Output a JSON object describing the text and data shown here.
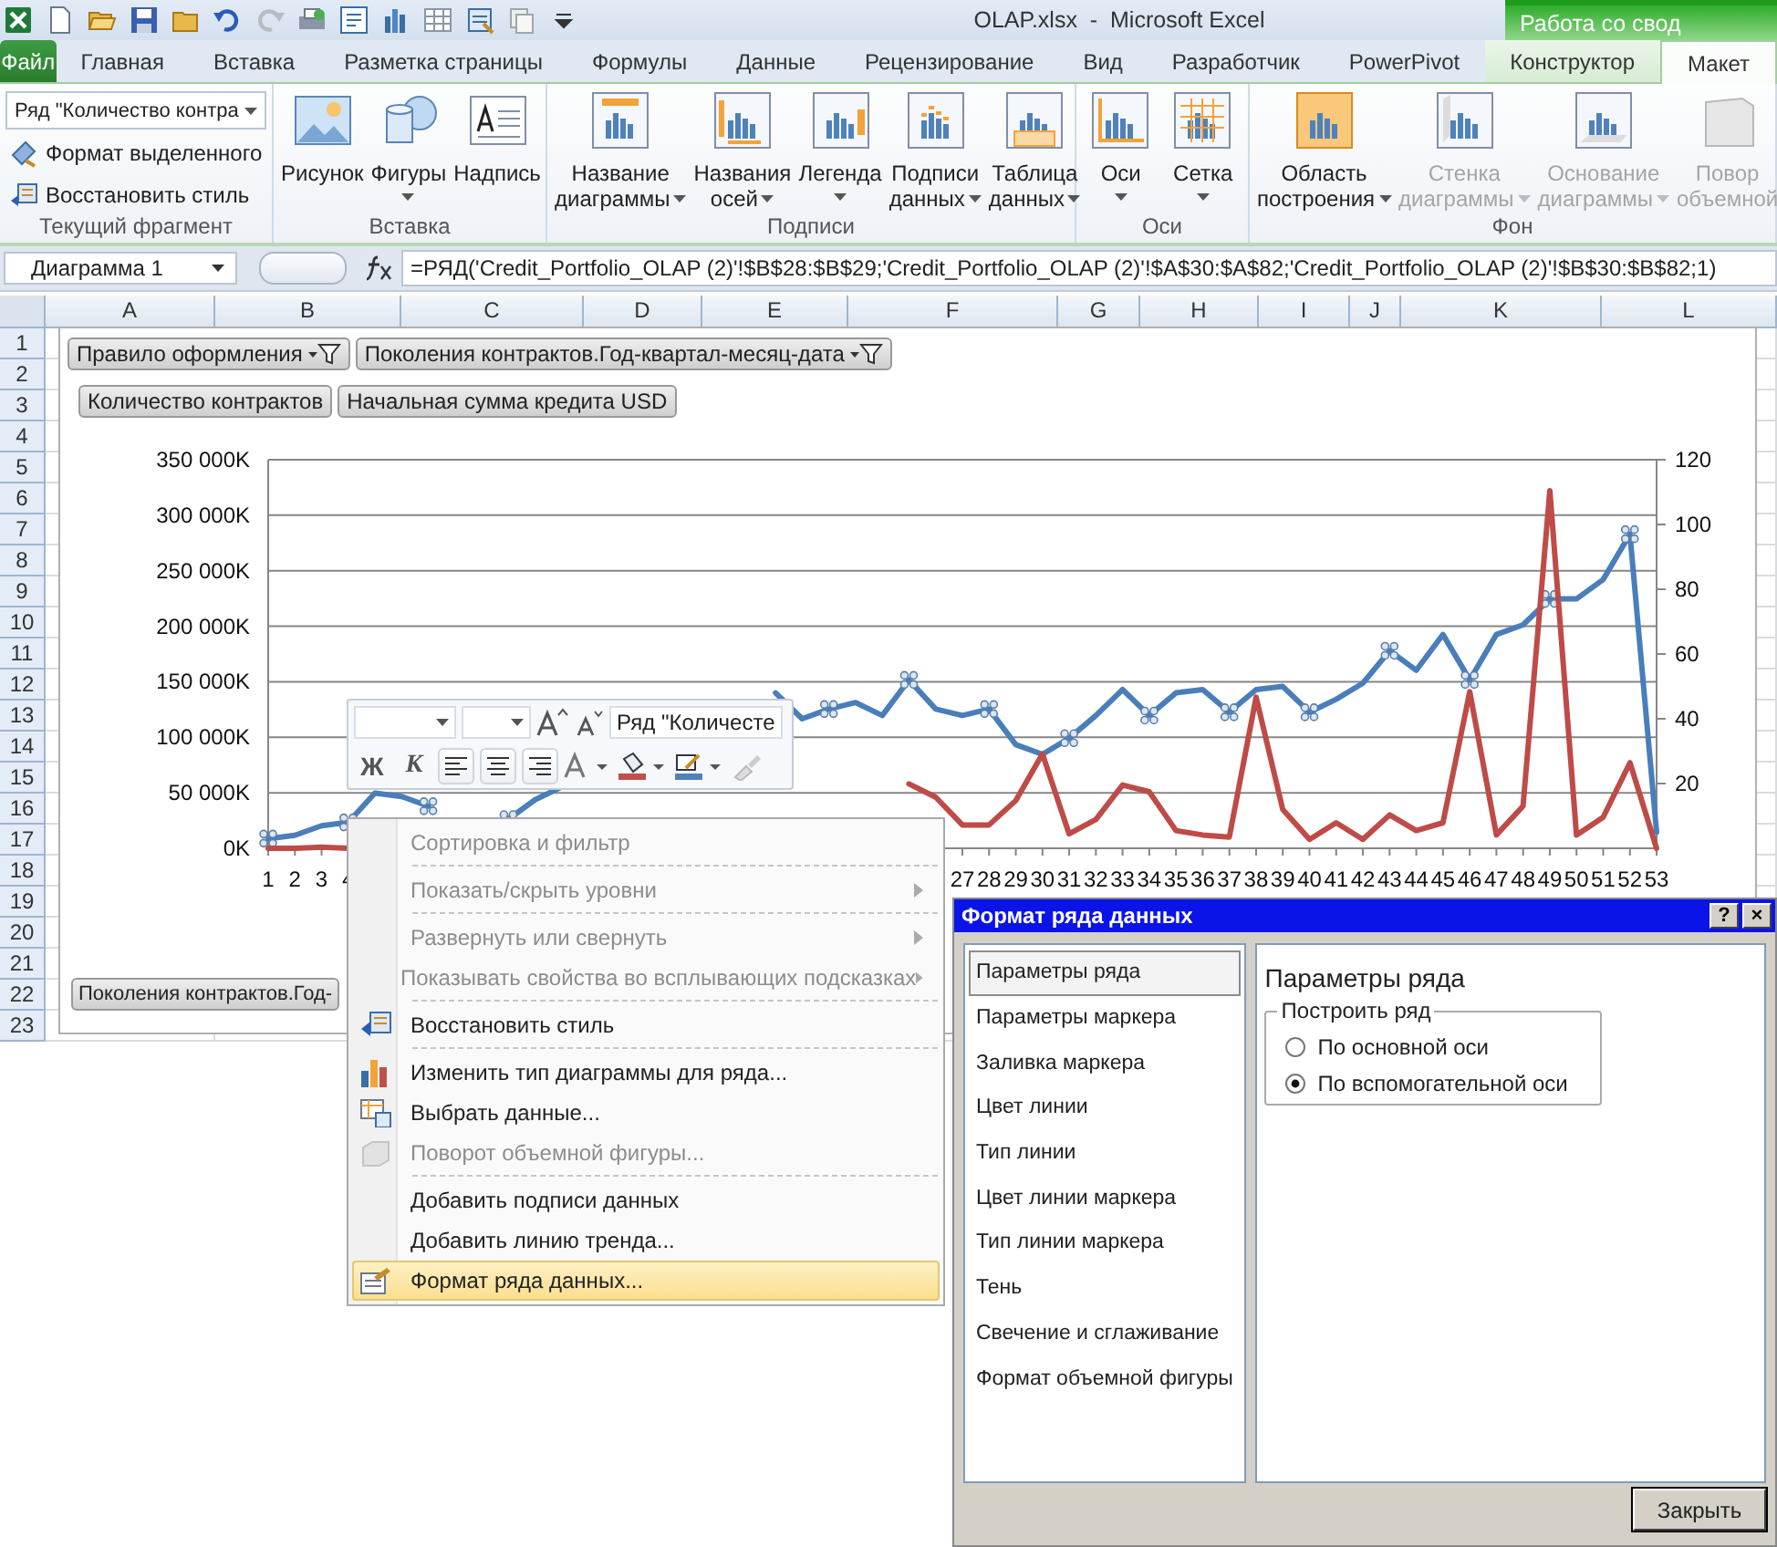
{
  "window": {
    "title": "OLAP.xlsx  -  Microsoft Excel",
    "contextual_header": "Работа со свод"
  },
  "tabs": [
    {
      "label": "Файл",
      "kind": "file",
      "selected": false
    },
    {
      "label": "Главная",
      "kind": "normal",
      "selected": false
    },
    {
      "label": "Вставка",
      "kind": "normal",
      "selected": false
    },
    {
      "label": "Разметка страницы",
      "kind": "normal",
      "selected": false
    },
    {
      "label": "Формулы",
      "kind": "normal",
      "selected": false
    },
    {
      "label": "Данные",
      "kind": "normal",
      "selected": false
    },
    {
      "label": "Рецензирование",
      "kind": "normal",
      "selected": false
    },
    {
      "label": "Вид",
      "kind": "normal",
      "selected": false
    },
    {
      "label": "Разработчик",
      "kind": "normal",
      "selected": false
    },
    {
      "label": "PowerPivot",
      "kind": "normal",
      "selected": false
    },
    {
      "label": "Конструктор",
      "kind": "contextual",
      "selected": false
    },
    {
      "label": "Макет",
      "kind": "contextual",
      "selected": true
    }
  ],
  "ribbon": {
    "groups": [
      {
        "label": "Текущий фрагмент",
        "kind": "selection",
        "selector": "Ряд \"Количество контра",
        "buttons": [
          {
            "label": "Формат выделенного"
          },
          {
            "label": "Восстановить стиль"
          }
        ]
      },
      {
        "label": "Вставка",
        "kind": "large",
        "buttons": [
          {
            "lines": [
              "Рисунок"
            ],
            "dropdown": false,
            "disabled": false
          },
          {
            "lines": [
              "Фигуры"
            ],
            "dropdown": true,
            "disabled": false
          },
          {
            "lines": [
              "Надпись"
            ],
            "dropdown": false,
            "disabled": false
          }
        ]
      },
      {
        "label": "Подписи",
        "kind": "large",
        "buttons": [
          {
            "lines": [
              "Название",
              "диаграммы"
            ],
            "dropdown": true,
            "disabled": false
          },
          {
            "lines": [
              "Названия",
              "осей"
            ],
            "dropdown": true,
            "disabled": false
          },
          {
            "lines": [
              "Легенда"
            ],
            "dropdown": true,
            "disabled": false
          },
          {
            "lines": [
              "Подписи",
              "данных"
            ],
            "dropdown": true,
            "disabled": false
          },
          {
            "lines": [
              "Таблица",
              "данных"
            ],
            "dropdown": true,
            "disabled": false
          }
        ]
      },
      {
        "label": "Оси",
        "kind": "large",
        "buttons": [
          {
            "lines": [
              "Оси"
            ],
            "dropdown": true,
            "disabled": false
          },
          {
            "lines": [
              "Сетка"
            ],
            "dropdown": true,
            "disabled": false
          }
        ]
      },
      {
        "label": "Фон",
        "kind": "large",
        "buttons": [
          {
            "lines": [
              "Область",
              "построения"
            ],
            "dropdown": true,
            "disabled": false
          },
          {
            "lines": [
              "Стенка",
              "диаграммы"
            ],
            "dropdown": true,
            "disabled": true
          },
          {
            "lines": [
              "Основание",
              "диаграммы"
            ],
            "dropdown": true,
            "disabled": true
          },
          {
            "lines": [
              "Повор",
              "объемной"
            ],
            "dropdown": false,
            "disabled": true
          }
        ]
      }
    ]
  },
  "formula_bar": {
    "name_box": "Диаграмма 1",
    "formula": "=РЯД('Credit_Portfolio_OLAP (2)'!$B$28:$B$29;'Credit_Portfolio_OLAP (2)'!$A$30:$A$82;'Credit_Portfolio_OLAP (2)'!$B$30:$B$82;1)"
  },
  "sheet": {
    "columns": [
      "A",
      "B",
      "C",
      "D",
      "E",
      "F",
      "G",
      "H",
      "I",
      "J",
      "K",
      "L"
    ],
    "rows": [
      "1",
      "2",
      "3",
      "4",
      "5",
      "6",
      "7",
      "8",
      "9",
      "10",
      "11",
      "12",
      "13",
      "14",
      "15",
      "16",
      "17",
      "18",
      "19",
      "20",
      "21",
      "22",
      "23"
    ]
  },
  "chart": {
    "filter_buttons": [
      {
        "label": "Правило оформления",
        "filter": true
      },
      {
        "label": "Поколения контрактов.Год-квартал-месяц-дата",
        "filter": true
      }
    ],
    "axis_button": "Поколения контрактов.Год-",
    "chart_data": {
      "type": "line",
      "x": [
        1,
        2,
        3,
        4,
        5,
        6,
        7,
        8,
        9,
        10,
        11,
        12,
        13,
        14,
        15,
        16,
        17,
        18,
        19,
        20,
        21,
        22,
        23,
        24,
        25,
        26,
        27,
        28,
        29,
        30,
        31,
        32,
        33,
        34,
        35,
        36,
        37,
        38,
        39,
        40,
        41,
        42,
        43,
        44,
        45,
        46,
        47,
        48,
        49,
        50,
        51,
        52,
        53
      ],
      "xlim": [
        1,
        53
      ],
      "xticks": [
        1,
        2,
        3,
        4,
        27,
        28,
        29,
        30,
        31,
        32,
        33,
        34,
        35,
        36,
        37,
        38,
        39,
        40,
        41,
        42,
        43,
        44,
        45,
        46,
        47,
        48,
        49,
        50,
        51,
        52,
        53
      ],
      "grid": true,
      "ylim": [
        0,
        350000
      ],
      "yticks": [
        {
          "value": 0,
          "label": "0K"
        },
        {
          "value": 50000,
          "label": "50 000K"
        },
        {
          "value": 100000,
          "label": "100 000K"
        },
        {
          "value": 150000,
          "label": "150 000K"
        },
        {
          "value": 200000,
          "label": "200 000K"
        },
        {
          "value": 250000,
          "label": "250 000K"
        },
        {
          "value": 300000,
          "label": "300 000K"
        },
        {
          "value": 350000,
          "label": "350 000K"
        }
      ],
      "y2lim": [
        0,
        120
      ],
      "y2ticks": [
        20,
        40,
        60,
        80,
        100,
        120
      ],
      "series": [
        {
          "name": "Количество контрактов",
          "color": "#4a7ebb",
          "axis": "y2",
          "values": [
            3,
            4,
            7,
            8,
            17,
            16,
            13,
            null,
            null,
            9,
            15,
            19,
            null,
            null,
            null,
            null,
            null,
            null,
            null,
            48,
            40,
            43,
            45,
            41,
            52,
            43,
            41,
            43,
            32,
            29,
            34,
            41,
            49,
            41,
            48,
            49,
            42,
            49,
            50,
            42,
            46,
            51,
            61,
            55,
            66,
            52,
            66,
            69,
            77,
            77,
            83,
            97,
            5
          ]
        },
        {
          "name": "Начальная сумма кредита USD",
          "color": "#be4b48",
          "values": [
            0,
            0,
            1000,
            0,
            null,
            null,
            null,
            null,
            null,
            null,
            null,
            null,
            null,
            null,
            null,
            null,
            null,
            null,
            null,
            null,
            null,
            null,
            null,
            null,
            58000,
            46000,
            21000,
            21000,
            43000,
            85000,
            13000,
            26000,
            57000,
            51000,
            16000,
            12000,
            10000,
            136000,
            35000,
            8000,
            23000,
            8000,
            30000,
            16000,
            23000,
            141000,
            12000,
            38000,
            322000,
            12000,
            28000,
            77000,
            0
          ]
        }
      ]
    }
  },
  "mini_toolbar": {
    "series_selector": "Ряд \"Количесте",
    "bold": "Ж",
    "italic": "К"
  },
  "context_menu": [
    {
      "label": "Сортировка и фильтр",
      "disabled": true,
      "submenu": false,
      "separator": true,
      "selected": false
    },
    {
      "label": "Показать/скрыть уровни",
      "disabled": true,
      "submenu": true,
      "separator": true,
      "selected": false
    },
    {
      "label": "Развернуть или свернуть",
      "disabled": true,
      "submenu": true,
      "separator": false,
      "selected": false
    },
    {
      "label": "Показывать свойства во всплывающих подсказках",
      "disabled": true,
      "submenu": true,
      "separator": true,
      "selected": false
    },
    {
      "label": "Восстановить стиль",
      "disabled": false,
      "submenu": false,
      "separator": true,
      "selected": false
    },
    {
      "label": "Изменить тип диаграммы для ряда...",
      "disabled": false,
      "submenu": false,
      "separator": false,
      "selected": false
    },
    {
      "label": "Выбрать данные...",
      "disabled": false,
      "submenu": false,
      "separator": false,
      "selected": false
    },
    {
      "label": "Поворот объемной фигуры...",
      "disabled": true,
      "submenu": false,
      "separator": true,
      "selected": false
    },
    {
      "label": "Добавить подписи данных",
      "disabled": false,
      "submenu": false,
      "separator": false,
      "selected": false
    },
    {
      "label": "Добавить линию тренда...",
      "disabled": false,
      "submenu": false,
      "separator": false,
      "selected": false
    },
    {
      "label": "Формат ряда данных...",
      "disabled": false,
      "submenu": false,
      "separator": false,
      "selected": true
    }
  ],
  "dialog": {
    "title": "Формат ряда данных",
    "title_buttons": [
      "?",
      "×"
    ],
    "nav": [
      {
        "label": "Параметры ряда",
        "selected": true
      },
      {
        "label": "Параметры маркера",
        "selected": false
      },
      {
        "label": "Заливка маркера",
        "selected": false
      },
      {
        "label": "Цвет линии",
        "selected": false
      },
      {
        "label": "Тип линии",
        "selected": false
      },
      {
        "label": "Цвет линии маркера",
        "selected": false
      },
      {
        "label": "Тип линии маркера",
        "selected": false
      },
      {
        "label": "Тень",
        "selected": false
      },
      {
        "label": "Свечение и сглаживание",
        "selected": false
      },
      {
        "label": "Формат объемной фигуры",
        "selected": false
      }
    ],
    "heading": "Параметры ряда",
    "group_label": "Построить ряд",
    "options": [
      {
        "label": "По основной оси",
        "selected": false
      },
      {
        "label": "По вспомогательной оси",
        "selected": true
      }
    ],
    "close_button": "Закрыть"
  }
}
